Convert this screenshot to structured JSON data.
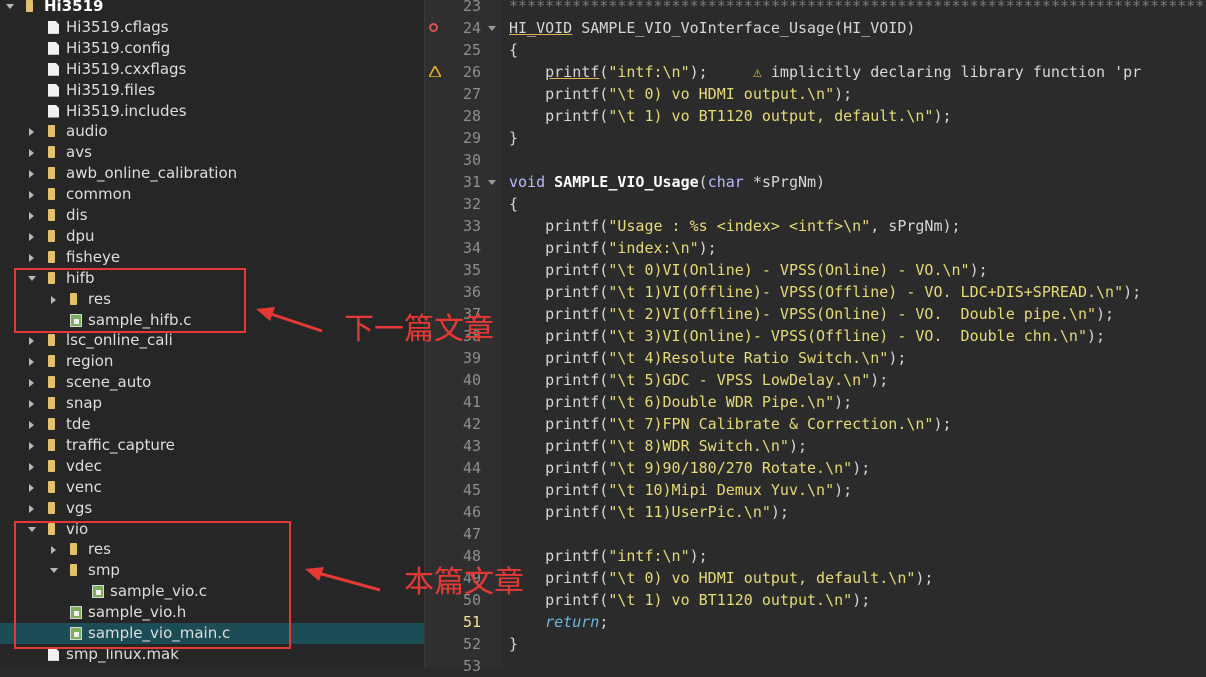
{
  "tree": {
    "items": [
      {
        "label": "Hi3519",
        "type": "folder",
        "depth": 0,
        "arrow": "expanded",
        "bold": true
      },
      {
        "label": "Hi3519.cflags",
        "type": "file",
        "depth": 1,
        "arrow": "none"
      },
      {
        "label": "Hi3519.config",
        "type": "file",
        "depth": 1,
        "arrow": "none"
      },
      {
        "label": "Hi3519.cxxflags",
        "type": "file",
        "depth": 1,
        "arrow": "none"
      },
      {
        "label": "Hi3519.files",
        "type": "file",
        "depth": 1,
        "arrow": "none"
      },
      {
        "label": "Hi3519.includes",
        "type": "file",
        "depth": 1,
        "arrow": "none"
      },
      {
        "label": "audio",
        "type": "folder",
        "depth": 1,
        "arrow": "collapsed"
      },
      {
        "label": "avs",
        "type": "folder",
        "depth": 1,
        "arrow": "collapsed"
      },
      {
        "label": "awb_online_calibration",
        "type": "folder",
        "depth": 1,
        "arrow": "collapsed"
      },
      {
        "label": "common",
        "type": "folder",
        "depth": 1,
        "arrow": "collapsed"
      },
      {
        "label": "dis",
        "type": "folder",
        "depth": 1,
        "arrow": "collapsed"
      },
      {
        "label": "dpu",
        "type": "folder",
        "depth": 1,
        "arrow": "collapsed"
      },
      {
        "label": "fisheye",
        "type": "folder",
        "depth": 1,
        "arrow": "collapsed"
      },
      {
        "label": "hifb",
        "type": "folder",
        "depth": 1,
        "arrow": "expanded"
      },
      {
        "label": "res",
        "type": "folder",
        "depth": 2,
        "arrow": "collapsed"
      },
      {
        "label": "sample_hifb.c",
        "type": "cfile",
        "depth": 2,
        "arrow": "none"
      },
      {
        "label": "lsc_online_cali",
        "type": "folder",
        "depth": 1,
        "arrow": "collapsed"
      },
      {
        "label": "region",
        "type": "folder",
        "depth": 1,
        "arrow": "collapsed"
      },
      {
        "label": "scene_auto",
        "type": "folder",
        "depth": 1,
        "arrow": "collapsed"
      },
      {
        "label": "snap",
        "type": "folder",
        "depth": 1,
        "arrow": "collapsed"
      },
      {
        "label": "tde",
        "type": "folder",
        "depth": 1,
        "arrow": "collapsed"
      },
      {
        "label": "traffic_capture",
        "type": "folder",
        "depth": 1,
        "arrow": "collapsed"
      },
      {
        "label": "vdec",
        "type": "folder",
        "depth": 1,
        "arrow": "collapsed"
      },
      {
        "label": "venc",
        "type": "folder",
        "depth": 1,
        "arrow": "collapsed"
      },
      {
        "label": "vgs",
        "type": "folder",
        "depth": 1,
        "arrow": "collapsed"
      },
      {
        "label": "vio",
        "type": "folder",
        "depth": 1,
        "arrow": "expanded"
      },
      {
        "label": "res",
        "type": "folder",
        "depth": 2,
        "arrow": "collapsed"
      },
      {
        "label": "smp",
        "type": "folder",
        "depth": 2,
        "arrow": "expanded"
      },
      {
        "label": "sample_vio.c",
        "type": "cfile",
        "depth": 3,
        "arrow": "none"
      },
      {
        "label": "sample_vio.h",
        "type": "cfile",
        "depth": 2,
        "arrow": "none"
      },
      {
        "label": "sample_vio_main.c",
        "type": "cfile",
        "depth": 2,
        "arrow": "none",
        "selected": true
      },
      {
        "label": "smp_linux.mak",
        "type": "file",
        "depth": 1,
        "arrow": "none"
      }
    ]
  },
  "editor": {
    "current_line": 51,
    "lines": [
      {
        "n": "23",
        "parts": [
          {
            "c": "stars",
            "t": "*******************************************************************************************"
          }
        ]
      },
      {
        "n": "24",
        "marker": "breakpoint",
        "fold": true,
        "parts": [
          {
            "c": "u",
            "t": "HI_VOID"
          },
          {
            "c": "",
            "t": " SAMPLE_VIO_VoInterface_Usage(HI_VOID)"
          }
        ]
      },
      {
        "n": "25",
        "parts": [
          {
            "c": "",
            "t": "{"
          }
        ]
      },
      {
        "n": "26",
        "marker": "warning",
        "parts": [
          {
            "c": "",
            "t": "    "
          },
          {
            "c": "u",
            "t": "printf"
          },
          {
            "c": "",
            "t": "("
          },
          {
            "c": "s",
            "t": "\"intf:\\n\""
          },
          {
            "c": "",
            "t": ");"
          }
        ]
      },
      {
        "n": "27",
        "parts": [
          {
            "c": "",
            "t": "    printf("
          },
          {
            "c": "s",
            "t": "\"\\t 0) vo HDMI output.\\n\""
          },
          {
            "c": "",
            "t": ");"
          }
        ]
      },
      {
        "n": "28",
        "parts": [
          {
            "c": "",
            "t": "    printf("
          },
          {
            "c": "s",
            "t": "\"\\t 1) vo BT1120 output, default.\\n\""
          },
          {
            "c": "",
            "t": ");"
          }
        ]
      },
      {
        "n": "29",
        "parts": [
          {
            "c": "",
            "t": "}"
          }
        ]
      },
      {
        "n": "30",
        "parts": [
          {
            "c": "",
            "t": ""
          }
        ]
      },
      {
        "n": "31",
        "fold": true,
        "parts": [
          {
            "c": "ty",
            "t": "void"
          },
          {
            "c": "",
            "t": " "
          },
          {
            "c": "fn",
            "t": "SAMPLE_VIO_Usage"
          },
          {
            "c": "",
            "t": "("
          },
          {
            "c": "ty",
            "t": "char"
          },
          {
            "c": "",
            "t": " *sPrgNm)"
          }
        ]
      },
      {
        "n": "32",
        "parts": [
          {
            "c": "",
            "t": "{"
          }
        ]
      },
      {
        "n": "33",
        "parts": [
          {
            "c": "",
            "t": "    printf("
          },
          {
            "c": "s",
            "t": "\"Usage : %s <index> <intf>\\n\""
          },
          {
            "c": "",
            "t": ", sPrgNm);"
          }
        ]
      },
      {
        "n": "34",
        "parts": [
          {
            "c": "",
            "t": "    printf("
          },
          {
            "c": "s",
            "t": "\"index:\\n\""
          },
          {
            "c": "",
            "t": ");"
          }
        ]
      },
      {
        "n": "35",
        "parts": [
          {
            "c": "",
            "t": "    printf("
          },
          {
            "c": "s",
            "t": "\"\\t 0)VI(Online) - VPSS(Online) - VO.\\n\""
          },
          {
            "c": "",
            "t": ");"
          }
        ]
      },
      {
        "n": "36",
        "parts": [
          {
            "c": "",
            "t": "    printf("
          },
          {
            "c": "s",
            "t": "\"\\t 1)VI(Offline)- VPSS(Offline) - VO. LDC+DIS+SPREAD.\\n\""
          },
          {
            "c": "",
            "t": ");"
          }
        ]
      },
      {
        "n": "37",
        "parts": [
          {
            "c": "",
            "t": "    printf("
          },
          {
            "c": "s",
            "t": "\"\\t 2)VI(Offline)- VPSS(Online) - VO.  Double pipe.\\n\""
          },
          {
            "c": "",
            "t": ");"
          }
        ]
      },
      {
        "n": "38",
        "parts": [
          {
            "c": "",
            "t": "    printf("
          },
          {
            "c": "s",
            "t": "\"\\t 3)VI(Online)- VPSS(Offline) - VO.  Double chn.\\n\""
          },
          {
            "c": "",
            "t": ");"
          }
        ]
      },
      {
        "n": "39",
        "parts": [
          {
            "c": "",
            "t": "    printf("
          },
          {
            "c": "s",
            "t": "\"\\t 4)Resolute Ratio Switch.\\n\""
          },
          {
            "c": "",
            "t": ");"
          }
        ]
      },
      {
        "n": "40",
        "parts": [
          {
            "c": "",
            "t": "    printf("
          },
          {
            "c": "s",
            "t": "\"\\t 5)GDC - VPSS LowDelay.\\n\""
          },
          {
            "c": "",
            "t": ");"
          }
        ]
      },
      {
        "n": "41",
        "parts": [
          {
            "c": "",
            "t": "    printf("
          },
          {
            "c": "s",
            "t": "\"\\t 6)Double WDR Pipe.\\n\""
          },
          {
            "c": "",
            "t": ");"
          }
        ]
      },
      {
        "n": "42",
        "parts": [
          {
            "c": "",
            "t": "    printf("
          },
          {
            "c": "s",
            "t": "\"\\t 7)FPN Calibrate & Correction.\\n\""
          },
          {
            "c": "",
            "t": ");"
          }
        ]
      },
      {
        "n": "43",
        "parts": [
          {
            "c": "",
            "t": "    printf("
          },
          {
            "c": "s",
            "t": "\"\\t 8)WDR Switch.\\n\""
          },
          {
            "c": "",
            "t": ");"
          }
        ]
      },
      {
        "n": "44",
        "parts": [
          {
            "c": "",
            "t": "    printf("
          },
          {
            "c": "s",
            "t": "\"\\t 9)90/180/270 Rotate.\\n\""
          },
          {
            "c": "",
            "t": ");"
          }
        ]
      },
      {
        "n": "45",
        "parts": [
          {
            "c": "",
            "t": "    printf("
          },
          {
            "c": "s",
            "t": "\"\\t 10)Mipi Demux Yuv.\\n\""
          },
          {
            "c": "",
            "t": ");"
          }
        ]
      },
      {
        "n": "46",
        "parts": [
          {
            "c": "",
            "t": "    printf("
          },
          {
            "c": "s",
            "t": "\"\\t 11)UserPic.\\n\""
          },
          {
            "c": "",
            "t": ");"
          }
        ]
      },
      {
        "n": "47",
        "parts": [
          {
            "c": "",
            "t": ""
          }
        ]
      },
      {
        "n": "48",
        "parts": [
          {
            "c": "",
            "t": "    printf("
          },
          {
            "c": "s",
            "t": "\"intf:\\n\""
          },
          {
            "c": "",
            "t": ");"
          }
        ]
      },
      {
        "n": "49",
        "parts": [
          {
            "c": "",
            "t": "    printf("
          },
          {
            "c": "s",
            "t": "\"\\t 0) vo HDMI output, default.\\n\""
          },
          {
            "c": "",
            "t": ");"
          }
        ]
      },
      {
        "n": "50",
        "parts": [
          {
            "c": "",
            "t": "    printf("
          },
          {
            "c": "s",
            "t": "\"\\t 1) vo BT1120 output.\\n\""
          },
          {
            "c": "",
            "t": ");"
          }
        ]
      },
      {
        "n": "51",
        "parts": [
          {
            "c": "",
            "t": "    "
          },
          {
            "c": "ret",
            "t": "return"
          },
          {
            "c": "",
            "t": ";"
          }
        ]
      },
      {
        "n": "52",
        "parts": [
          {
            "c": "",
            "t": "}"
          }
        ]
      },
      {
        "n": "53",
        "parts": [
          {
            "c": "",
            "t": ""
          }
        ]
      }
    ],
    "inline_hint": "implicitly declaring library function 'pr"
  },
  "annotations": {
    "next_article": "下一篇文章",
    "this_article": "本篇文章"
  },
  "colors": {
    "annotation_red": "#e53935",
    "selection": "#1c4c56",
    "folder": "#e2c16a"
  }
}
